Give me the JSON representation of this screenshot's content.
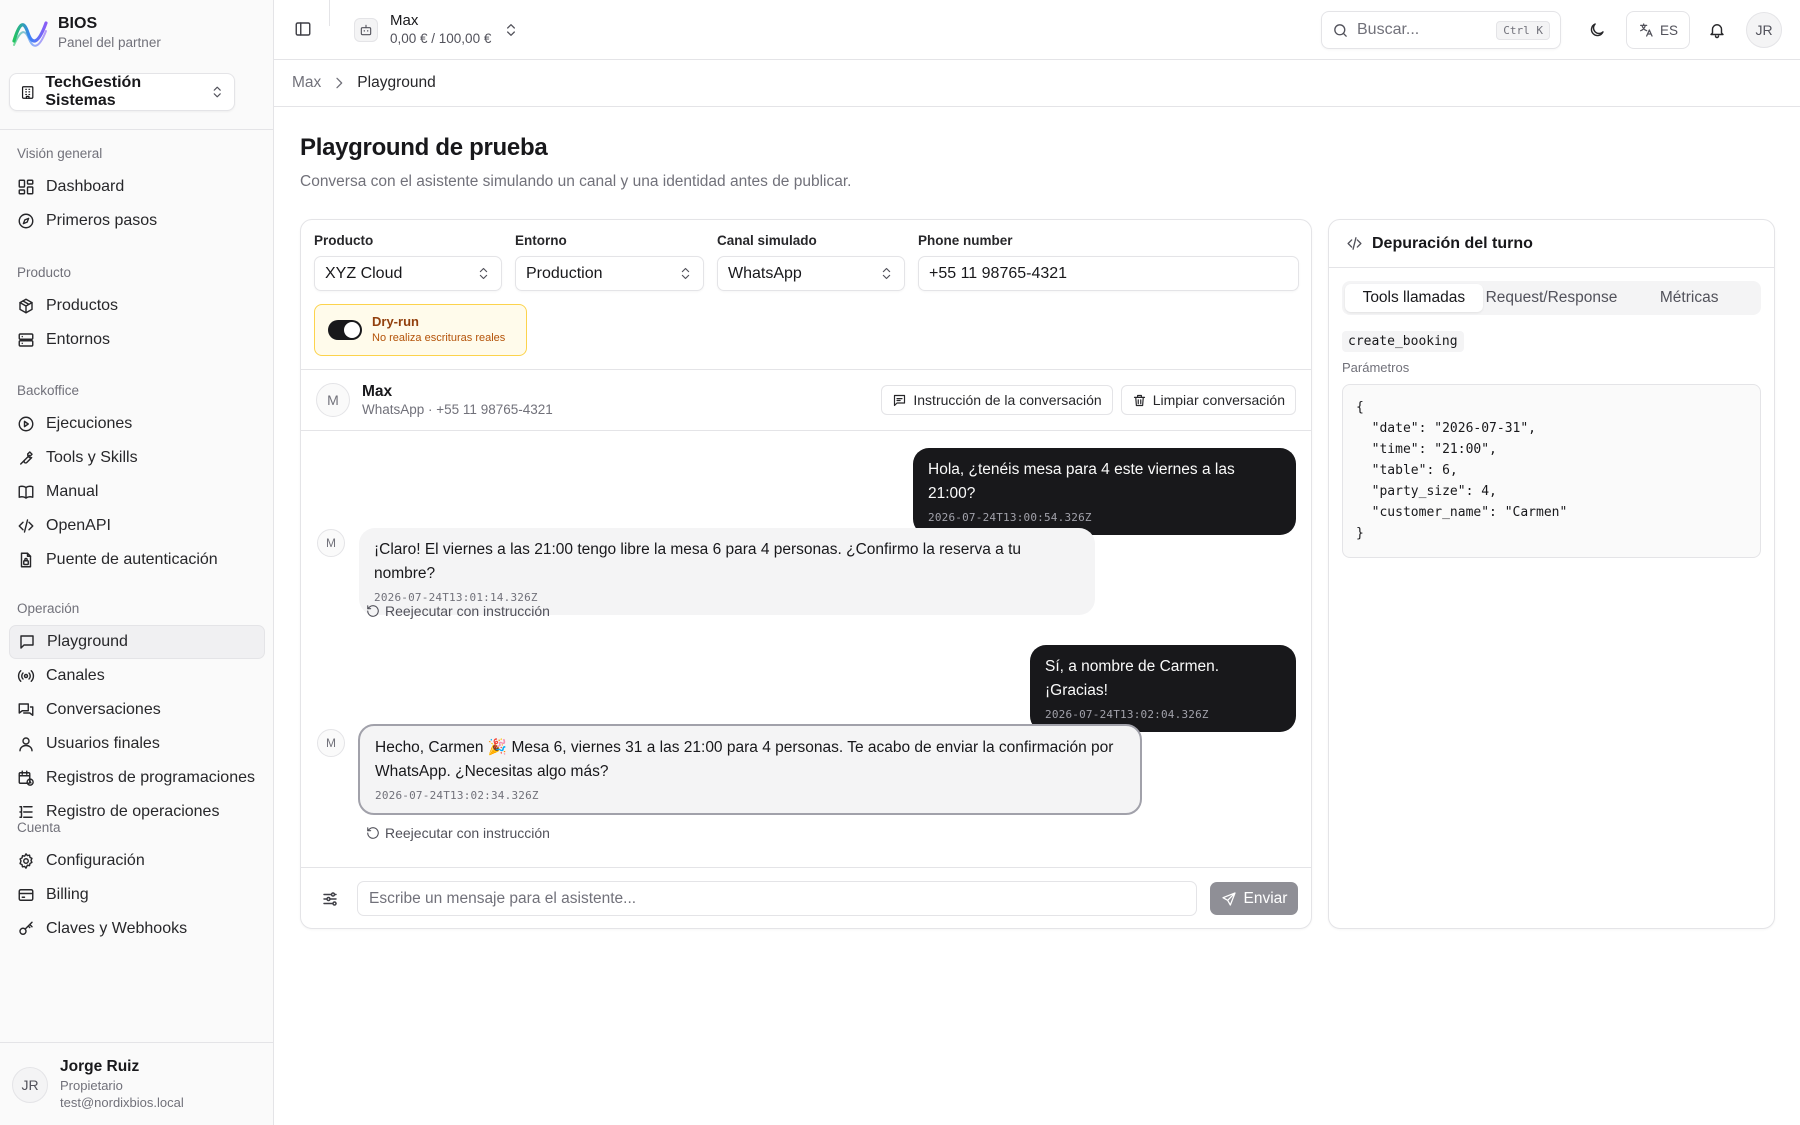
{
  "brand": {
    "name": "BIOS",
    "subtitle": "Panel del partner"
  },
  "org": {
    "name": "TechGestión Sistemas"
  },
  "nav": {
    "groups": [
      {
        "title": "Visión general",
        "items": [
          {
            "label": "Dashboard",
            "icon": "dashboard-icon"
          },
          {
            "label": "Primeros pasos",
            "icon": "compass-icon"
          }
        ]
      },
      {
        "title": "Producto",
        "items": [
          {
            "label": "Productos",
            "icon": "package-icon"
          },
          {
            "label": "Entornos",
            "icon": "server-icon"
          }
        ]
      },
      {
        "title": "Backoffice",
        "items": [
          {
            "label": "Ejecuciones",
            "icon": "play-circle-icon"
          },
          {
            "label": "Tools y Skills",
            "icon": "wrench-icon"
          },
          {
            "label": "Manual",
            "icon": "book-icon"
          },
          {
            "label": "OpenAPI",
            "icon": "code-icon"
          },
          {
            "label": "Puente de autenticación",
            "icon": "file-lock-icon"
          }
        ]
      },
      {
        "title": "Operación",
        "items": [
          {
            "label": "Playground",
            "icon": "message-icon",
            "active": true
          },
          {
            "label": "Canales",
            "icon": "radio-icon"
          },
          {
            "label": "Conversaciones",
            "icon": "messages-icon"
          },
          {
            "label": "Usuarios finales",
            "icon": "users-icon"
          },
          {
            "label": "Registros de programaciones",
            "icon": "calendar-clock-icon"
          },
          {
            "label": "Registro de operaciones",
            "icon": "logs-icon"
          }
        ]
      },
      {
        "title": "Cuenta",
        "items": [
          {
            "label": "Configuración",
            "icon": "gear-icon"
          },
          {
            "label": "Billing",
            "icon": "credit-card-icon"
          },
          {
            "label": "Claves y Webhooks",
            "icon": "key-icon"
          }
        ]
      }
    ]
  },
  "user": {
    "initials": "JR",
    "name": "Jorge Ruiz",
    "role": "Propietario",
    "email": "test@nordixbios.local"
  },
  "header": {
    "agent_name": "Max",
    "agent_cost": "0,00 € / 100,00 €",
    "search_placeholder": "Buscar...",
    "search_shortcut": "Ctrl K",
    "lang": "ES",
    "avatar_initials": "JR"
  },
  "breadcrumb": {
    "root": "Max",
    "current": "Playground"
  },
  "page": {
    "title": "Playground de prueba",
    "subtitle": "Conversa con el asistente simulando un canal y una identidad antes de publicar."
  },
  "config": {
    "product": {
      "label": "Producto",
      "value": "XYZ Cloud"
    },
    "environment": {
      "label": "Entorno",
      "value": "Production"
    },
    "channel": {
      "label": "Canal simulado",
      "value": "WhatsApp"
    },
    "phone": {
      "label": "Phone number",
      "value": "+55 11 98765-4321"
    },
    "dry_run": {
      "title": "Dry-run",
      "subtitle": "No realiza escrituras reales",
      "enabled": true
    }
  },
  "conversation": {
    "avatar": "M",
    "name": "Max",
    "meta": "WhatsApp · +55 11 98765-4321",
    "instruction_btn": "Instrucción de la conversación",
    "clear_btn": "Limpiar conversación",
    "rerun_label": "Reejecutar con instrucción",
    "messages": [
      {
        "role": "user",
        "text": "Hola, ¿tenéis mesa para 4 este viernes a las 21:00?",
        "ts": "2026-07-24T13:00:54.326Z"
      },
      {
        "role": "bot",
        "text": "¡Claro! El viernes a las 21:00 tengo libre la mesa 6 para 4 personas. ¿Confirmo la reserva a tu nombre?",
        "ts": "2026-07-24T13:01:14.326Z"
      },
      {
        "role": "user",
        "text": "Sí, a nombre de Carmen. ¡Gracias!",
        "ts": "2026-07-24T13:02:04.326Z"
      },
      {
        "role": "bot",
        "text": "Hecho, Carmen 🎉  Mesa 6, viernes 31 a las 21:00 para 4 personas. Te acabo de enviar la confirmación por WhatsApp. ¿Necesitas algo más?",
        "ts": "2026-07-24T13:02:34.326Z"
      }
    ]
  },
  "composer": {
    "placeholder": "Escribe un mensaje para el asistente...",
    "send": "Enviar"
  },
  "debug": {
    "title": "Depuración del turno",
    "tabs": [
      "Tools llamadas",
      "Request/Response",
      "Métricas"
    ],
    "active_tab": 0,
    "tool_name": "create_booking",
    "params_label": "Parámetros",
    "params_json": "{\n  \"date\": \"2026-07-31\",\n  \"time\": \"21:00\",\n  \"table\": 6,\n  \"party_size\": 4,\n  \"customer_name\": \"Carmen\"\n}"
  }
}
